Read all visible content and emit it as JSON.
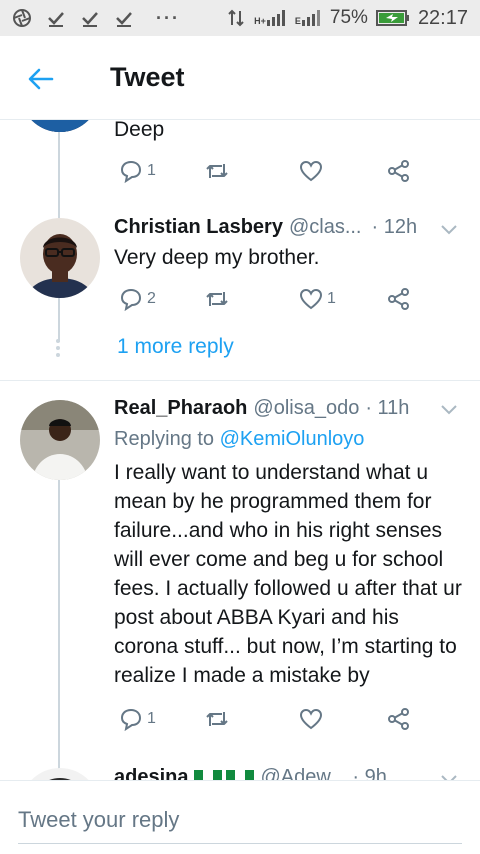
{
  "status_bar": {
    "battery": "75%",
    "time": "22:17",
    "network_a": "H+",
    "network_b": "E"
  },
  "header": {
    "title": "Tweet"
  },
  "tweets": [
    {
      "text": "Deep",
      "reply_count": "1",
      "like_count": ""
    },
    {
      "name": "Christian Lasbery",
      "handle": "@clas...",
      "time": "· 12h",
      "text": "Very deep my brother.",
      "reply_count": "2",
      "like_count": "1"
    },
    {
      "name": "Real_Pharaoh",
      "handle": "@olisa_odo",
      "time": "· 11h",
      "replying_label": "Replying to",
      "replying_to": "@KemiOlunloyo",
      "text": "I really want to understand what u mean by he programmed them for failure...and who in his right senses will ever come and beg u for school fees. I actually followed u after that ur post about ABBA Kyari and his corona stuff... but now, I’m starting to realize I made a mistake by",
      "reply_count": "1",
      "like_count": ""
    },
    {
      "name": "adesina",
      "handle": "@Adew...",
      "time": "· 9h"
    }
  ],
  "more_reply": "1 more reply",
  "reply_bar": {
    "placeholder": "Tweet your reply"
  },
  "colors": {
    "accent": "#1da1f2",
    "muted": "#657786",
    "line": "#ccd6dd"
  }
}
